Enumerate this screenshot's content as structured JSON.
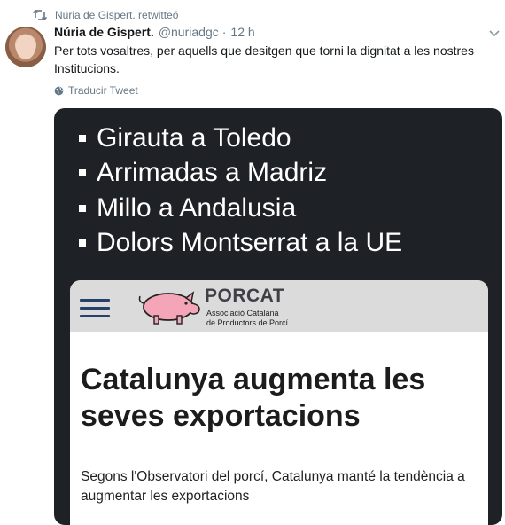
{
  "retweet": {
    "text": "Núria de Gispert. retwitteó"
  },
  "tweet": {
    "author_name": "Núria de Gispert.",
    "handle": "@nuriadgc",
    "separator": "·",
    "time": "12 h",
    "text": "Per tots vosaltres, per aquells que desitgen que torni la dignitat a les nostres Institucions.",
    "translate_label": "Traducir Tweet"
  },
  "media": {
    "bullets": [
      "Girauta a Toledo",
      "Arrimadas a Madriz",
      "Millo a Andalusia",
      "Dolors Montserrat a la UE"
    ],
    "article": {
      "logo_title": "PORCAT",
      "logo_sub_line1": "Associació Catalana",
      "logo_sub_line2": "de Productors de Porcí",
      "headline": "Catalunya augmenta les seves exportacions",
      "summary": "Segons l'Observatori del porcí, Catalunya manté la tendència a augmentar les exportacions"
    }
  },
  "colors": {
    "text_primary": "#14171a",
    "text_secondary": "#657786",
    "card_bg": "#1e2126",
    "pig_pink": "#f4a5b8",
    "menu_blue": "#27406b"
  },
  "icons": {
    "retweet": "retweet-icon",
    "caret": "chevron-down-icon",
    "globe": "globe-icon",
    "menu": "hamburger-menu-icon",
    "pig": "pig-logo-icon"
  }
}
